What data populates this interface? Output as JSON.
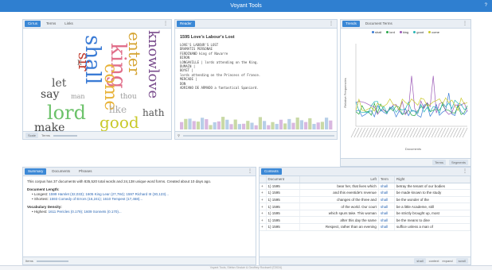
{
  "app": {
    "title": "Voyant Tools",
    "help_label": "?"
  },
  "cirrus": {
    "tabs": [
      "Cirrus",
      "Terms",
      "Links"
    ],
    "words": [
      "knowlove",
      "enter",
      "king",
      "shall",
      "come",
      "lord",
      "good",
      "sir",
      "let",
      "say",
      "make",
      "like",
      "hath",
      "thou",
      "ll",
      "man",
      "love",
      "know"
    ],
    "foot": [
      "Scale",
      "Terms"
    ]
  },
  "reader": {
    "tab": "Reader",
    "doc_title": "1595 Love's Labour's Lost",
    "lines": [
      "LOVE'S LABOUR'S LOST",
      "DRAMATIS PERSONAE",
      "FERDINAND king of Navarre",
      "BIRON",
      "",
      "LONGAVILLE | lords attending on the King.",
      "",
      "DUMAIN |",
      "BOYET |",
      "lords attending on the Princess of France.",
      "MERCADE |",
      "DON",
      "ADRIANO DE ARMADO a fantastical Spaniard."
    ]
  },
  "trends": {
    "tabs": [
      "Trends",
      "Document Terms"
    ],
    "xlabel": "Documents",
    "ylabel": "Relative Frequencies",
    "legend": [
      {
        "name": "shall",
        "color": "#3a7bd5"
      },
      {
        "name": "lord",
        "color": "#2aa84a"
      },
      {
        "name": "king",
        "color": "#9b59b6"
      },
      {
        "name": "good",
        "color": "#27b6b6"
      },
      {
        "name": "come",
        "color": "#c9c92a"
      }
    ],
    "foot": [
      "Terms",
      "Segments"
    ]
  },
  "summary": {
    "tabs": [
      "Summary",
      "Documents",
      "Phrases"
    ],
    "intro": "This corpus has 37 documents with 835,520 total words and 24,138 unique word forms. Created about 10 days ago.",
    "doc_length_label": "Document Length:",
    "longest_label": "Longest:",
    "longest_text": "1599 Hamlet (32,033); 1605 King Lear (27,784); 1597 Richard III (30,123)...",
    "shortest_label": "Shortest:",
    "shortest_text": "1593 Comedy of Errors (16,241); 1610 Tempest (17,468)...",
    "vocab_label": "Vocabulary Density:",
    "highest_label": "Highest:",
    "highest_text": "1611 Pericles (0.179); 1609 Sonnets (0.170)...",
    "foot": "Items"
  },
  "contexts": {
    "tab": "Contexts",
    "columns": [
      "Document",
      "Left",
      "Term",
      "Right"
    ],
    "rows": [
      {
        "doc": "1) 1595",
        "left": "bear her, that lives which",
        "term": "shall",
        "right": "betray the tenant of our bodies"
      },
      {
        "doc": "1) 1595",
        "left": "and this eventide's revenue",
        "term": "shall",
        "right": "be made known to the study"
      },
      {
        "doc": "1) 1595",
        "left": "changes of the three and",
        "term": "shall",
        "right": "be the wonder of the"
      },
      {
        "doc": "1) 1595",
        "left": "of the world. Our court",
        "term": "shall",
        "right": "be a little Academe, still"
      },
      {
        "doc": "1) 1595",
        "left": "which spurs take. This woman",
        "term": "shall",
        "right": "be strictly brought up, most"
      },
      {
        "doc": "1) 1595",
        "left": "after this day the same",
        "term": "shall",
        "right": "be the means to dine"
      },
      {
        "doc": "1) 1595",
        "left": "Respect, rather than an evening",
        "term": "shall",
        "right": "suffice unless a man of"
      }
    ],
    "foot": [
      "shall",
      "context",
      "expand",
      "scroll"
    ]
  },
  "status": "Voyant Tools, Stéfan Sinclair & Geoffrey Rockwell (©2024)"
}
